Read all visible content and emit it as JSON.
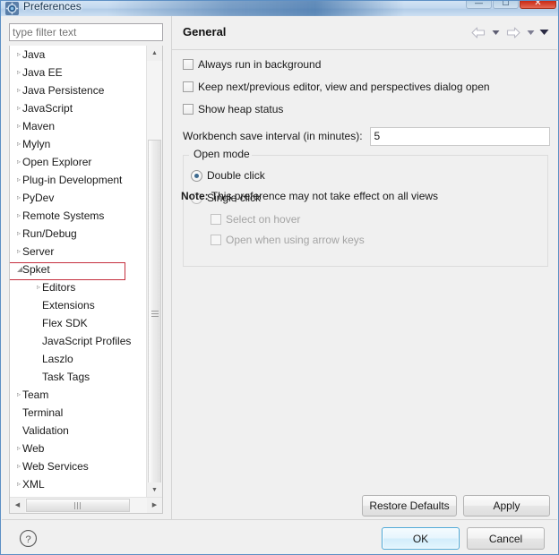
{
  "window": {
    "title": "Preferences",
    "icon": "preferences-gear-icon",
    "controls": {
      "minimize": "minimize-button",
      "maximize": "maximize-button",
      "close": "close-button",
      "minimize_glyph": "—",
      "maximize_glyph": "☐",
      "close_glyph": "✕"
    }
  },
  "filter": {
    "placeholder": "type filter text",
    "value": ""
  },
  "tree": {
    "items": [
      {
        "label": "Java",
        "depth": 0,
        "expandable": true,
        "expanded": false,
        "selected": false
      },
      {
        "label": "Java EE",
        "depth": 0,
        "expandable": true,
        "expanded": false,
        "selected": false
      },
      {
        "label": "Java Persistence",
        "depth": 0,
        "expandable": true,
        "expanded": false,
        "selected": false
      },
      {
        "label": "JavaScript",
        "depth": 0,
        "expandable": true,
        "expanded": false,
        "selected": false
      },
      {
        "label": "Maven",
        "depth": 0,
        "expandable": true,
        "expanded": false,
        "selected": false
      },
      {
        "label": "Mylyn",
        "depth": 0,
        "expandable": true,
        "expanded": false,
        "selected": false
      },
      {
        "label": "Open Explorer",
        "depth": 0,
        "expandable": true,
        "expanded": false,
        "selected": false
      },
      {
        "label": "Plug-in Development",
        "depth": 0,
        "expandable": true,
        "expanded": false,
        "selected": false
      },
      {
        "label": "PyDev",
        "depth": 0,
        "expandable": true,
        "expanded": false,
        "selected": false
      },
      {
        "label": "Remote Systems",
        "depth": 0,
        "expandable": true,
        "expanded": false,
        "selected": false
      },
      {
        "label": "Run/Debug",
        "depth": 0,
        "expandable": true,
        "expanded": false,
        "selected": false
      },
      {
        "label": "Server",
        "depth": 0,
        "expandable": true,
        "expanded": false,
        "selected": false
      },
      {
        "label": "Spket",
        "depth": 0,
        "expandable": true,
        "expanded": true,
        "selected": true
      },
      {
        "label": "Editors",
        "depth": 1,
        "expandable": true,
        "expanded": false,
        "selected": false
      },
      {
        "label": "Extensions",
        "depth": 1,
        "expandable": false,
        "expanded": false,
        "selected": false
      },
      {
        "label": "Flex SDK",
        "depth": 1,
        "expandable": false,
        "expanded": false,
        "selected": false
      },
      {
        "label": "JavaScript Profiles",
        "depth": 1,
        "expandable": false,
        "expanded": false,
        "selected": false
      },
      {
        "label": "Laszlo",
        "depth": 1,
        "expandable": false,
        "expanded": false,
        "selected": false
      },
      {
        "label": "Task Tags",
        "depth": 1,
        "expandable": false,
        "expanded": false,
        "selected": false
      },
      {
        "label": "Team",
        "depth": 0,
        "expandable": true,
        "expanded": false,
        "selected": false
      },
      {
        "label": "Terminal",
        "depth": 0,
        "expandable": false,
        "expanded": false,
        "selected": false
      },
      {
        "label": "Validation",
        "depth": 0,
        "expandable": false,
        "expanded": false,
        "selected": false
      },
      {
        "label": "Web",
        "depth": 0,
        "expandable": true,
        "expanded": false,
        "selected": false
      },
      {
        "label": "Web Services",
        "depth": 0,
        "expandable": true,
        "expanded": false,
        "selected": false
      },
      {
        "label": "XML",
        "depth": 0,
        "expandable": true,
        "expanded": false,
        "selected": false
      }
    ],
    "collapsed_glyph": "▹",
    "expanded_glyph": "◢",
    "scroll_up_glyph": "▲",
    "scroll_down_glyph": "▼",
    "scroll_left_glyph": "◀",
    "scroll_right_glyph": "▶"
  },
  "pane": {
    "title": "General",
    "nav": {
      "back": "back-arrow-icon",
      "back_menu": "back-dropdown-icon",
      "forward": "forward-arrow-icon",
      "forward_menu": "forward-dropdown-icon",
      "view_menu": "view-menu-icon",
      "dropdown_glyph": "▾"
    },
    "checkboxes": [
      {
        "label": "Always run in background",
        "checked": false,
        "enabled": true
      },
      {
        "label": "Keep next/previous editor, view and perspectives dialog open",
        "checked": false,
        "enabled": true
      },
      {
        "label": "Show heap status",
        "checked": false,
        "enabled": true
      }
    ],
    "save_interval": {
      "label": "Workbench save interval (in minutes):",
      "value": "5"
    },
    "open_mode": {
      "legend": "Open mode",
      "radios": [
        {
          "label": "Double click",
          "checked": true
        },
        {
          "label": "Single click",
          "checked": false
        }
      ],
      "sub_checkboxes": [
        {
          "label": "Select on hover",
          "checked": false,
          "enabled": false
        },
        {
          "label": "Open when using arrow keys",
          "checked": false,
          "enabled": false
        }
      ],
      "note_prefix": "Note:",
      "note_text": "This preference may not take effect on all views"
    },
    "buttons": {
      "restore_defaults": "Restore Defaults",
      "apply": "Apply"
    }
  },
  "footer": {
    "help_icon": "help-question-icon",
    "ok": "OK",
    "cancel": "Cancel"
  },
  "colors": {
    "accent": "#4aa7d6",
    "annotation": "#c52f3e",
    "titlebar": "#c3d9ef",
    "close_button": "#c92b16",
    "dialog_bg": "#f0f0f0"
  }
}
